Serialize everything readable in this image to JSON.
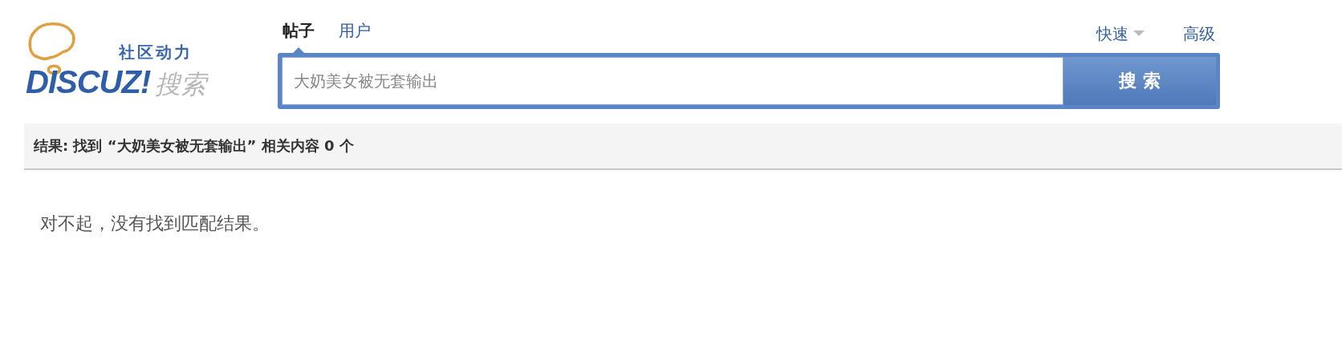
{
  "logo": {
    "tagline": "社区动力",
    "brand": "DISCUZ!",
    "suffix": "搜索"
  },
  "tabs": [
    {
      "label": "帖子",
      "selected": true
    },
    {
      "label": "用户",
      "selected": false
    }
  ],
  "links": [
    {
      "label": "快速",
      "kind": "dropdown"
    },
    {
      "label": "高级",
      "kind": "link"
    }
  ],
  "search": {
    "value": "大奶美女被无套输出",
    "button": "搜 索"
  },
  "results": {
    "summary": "结果: 找到 “大奶美女被无套输出” 相关内容 0 个",
    "message": "对不起，没有找到匹配结果。"
  }
}
